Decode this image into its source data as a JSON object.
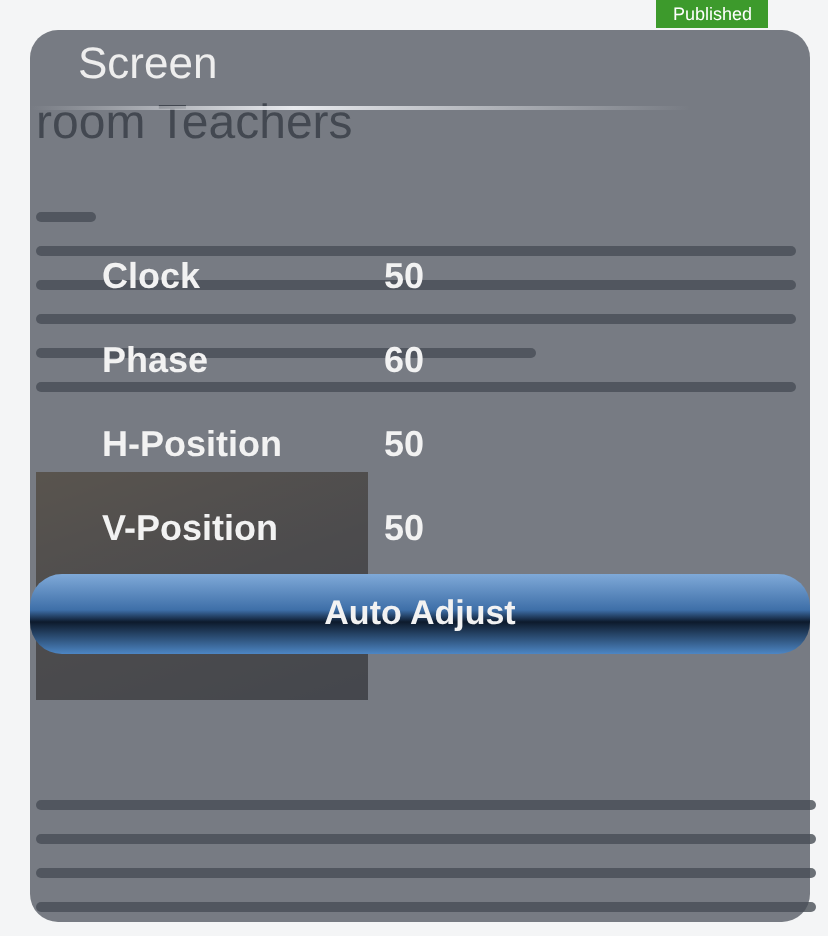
{
  "background_page": {
    "badge": "Published",
    "heading": "room Teachers"
  },
  "osd": {
    "title": "Screen",
    "items": [
      {
        "kind": "value",
        "label": "Clock",
        "value": "50",
        "selected": false
      },
      {
        "kind": "value",
        "label": "Phase",
        "value": "60",
        "selected": false
      },
      {
        "kind": "value",
        "label": "H-Position",
        "value": "50",
        "selected": false
      },
      {
        "kind": "value",
        "label": "V-Position",
        "value": "50",
        "selected": false
      },
      {
        "kind": "action",
        "label": "Auto Adjust",
        "selected": true
      }
    ]
  }
}
